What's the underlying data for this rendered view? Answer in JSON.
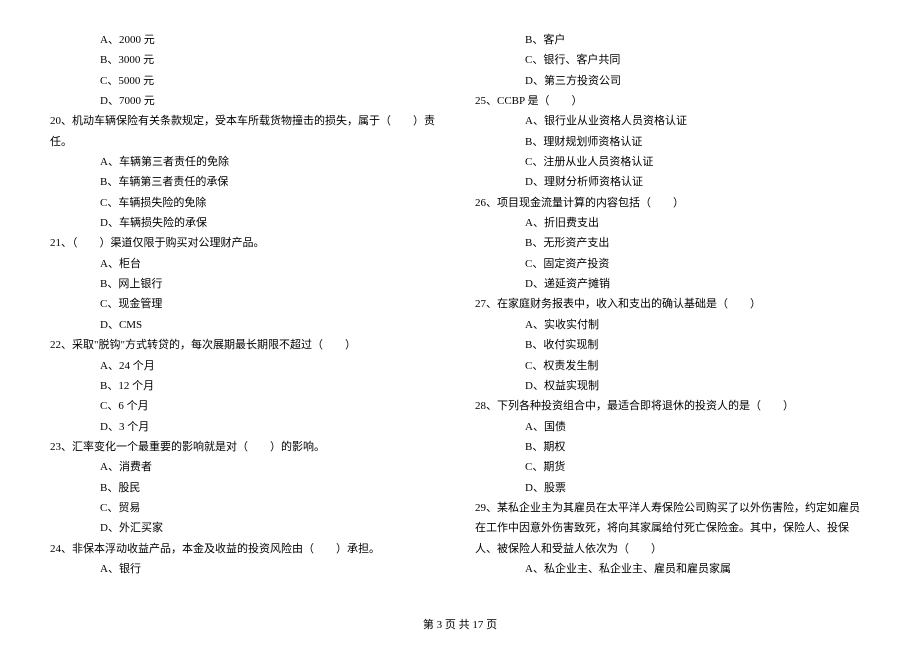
{
  "left": {
    "q19_options": [
      "A、2000 元",
      "B、3000 元",
      "C、5000 元",
      "D、7000 元"
    ],
    "q20": "20、机动车辆保险有关条款规定，受本车所载货物撞击的损失，属于（　　）责任。",
    "q20_options": [
      "A、车辆第三者责任的免除",
      "B、车辆第三者责任的承保",
      "C、车辆损失险的免除",
      "D、车辆损失险的承保"
    ],
    "q21": "21、（　　）渠道仅限于购买对公理财产品。",
    "q21_options": [
      "A、柜台",
      "B、网上银行",
      "C、现金管理",
      "D、CMS"
    ],
    "q22": "22、采取\"脱钩\"方式转贷的，每次展期最长期限不超过（　　）",
    "q22_options": [
      "A、24 个月",
      "B、12 个月",
      "C、6 个月",
      "D、3 个月"
    ],
    "q23": "23、汇率变化一个最重要的影响就是对（　　）的影响。",
    "q23_options": [
      "A、消费者",
      "B、股民",
      "C、贸易",
      "D、外汇买家"
    ],
    "q24": "24、非保本浮动收益产品，本金及收益的投资风险由（　　）承担。",
    "q24_options": [
      "A、银行"
    ]
  },
  "right": {
    "q24_options_cont": [
      "B、客户",
      "C、银行、客户共同",
      "D、第三方投资公司"
    ],
    "q25": "25、CCBP 是（　　）",
    "q25_options": [
      "A、银行业从业资格人员资格认证",
      "B、理财规划师资格认证",
      "C、注册从业人员资格认证",
      "D、理财分析师资格认证"
    ],
    "q26": "26、项目现金流量计算的内容包括（　　）",
    "q26_options": [
      "A、折旧费支出",
      "B、无形资产支出",
      "C、固定资产投资",
      "D、递延资产摊销"
    ],
    "q27": "27、在家庭财务报表中，收入和支出的确认基础是（　　）",
    "q27_options": [
      "A、实收实付制",
      "B、收付实现制",
      "C、权责发生制",
      "D、权益实现制"
    ],
    "q28": "28、下列各种投资组合中，最适合即将退休的投资人的是（　　）",
    "q28_options": [
      "A、国债",
      "B、期权",
      "C、期货",
      "D、股票"
    ],
    "q29": "29、某私企业主为其雇员在太平洋人寿保险公司购买了以外伤害险，约定如雇员在工作中因意外伤害致死，将向其家属给付死亡保险金。其中，保险人、投保人、被保险人和受益人依次为（　　）",
    "q29_options": [
      "A、私企业主、私企业主、雇员和雇员家属"
    ]
  },
  "footer": "第 3 页 共 17 页"
}
